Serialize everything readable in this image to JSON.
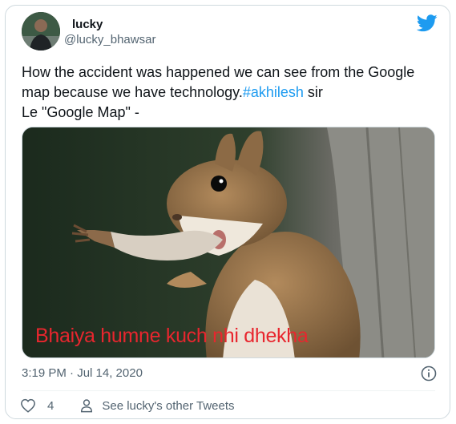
{
  "user": {
    "name": "lucky",
    "handle": "@lucky_bhawsar"
  },
  "tweet": {
    "text_line1": "How the accident was happened we can see from the Google",
    "text_line2_prefix": "map because we have technology.",
    "hashtag": "#akhilesh",
    "text_line2_suffix": " sir",
    "text_line3": "Le \"Google Map\" -"
  },
  "media": {
    "caption": "Bhaiya humne kuch nhi dhekha"
  },
  "meta": {
    "timestamp": "3:19 PM · Jul 14, 2020"
  },
  "actions": {
    "like_count": "4",
    "profile_link": "See lucky's other Tweets"
  },
  "icons": {
    "brand": "twitter-bird-icon",
    "info": "info-icon",
    "like": "heart-icon",
    "profile": "person-icon"
  },
  "colors": {
    "accent": "#1d9bf0",
    "caption": "#e8262e",
    "secondary_text": "#536471"
  }
}
